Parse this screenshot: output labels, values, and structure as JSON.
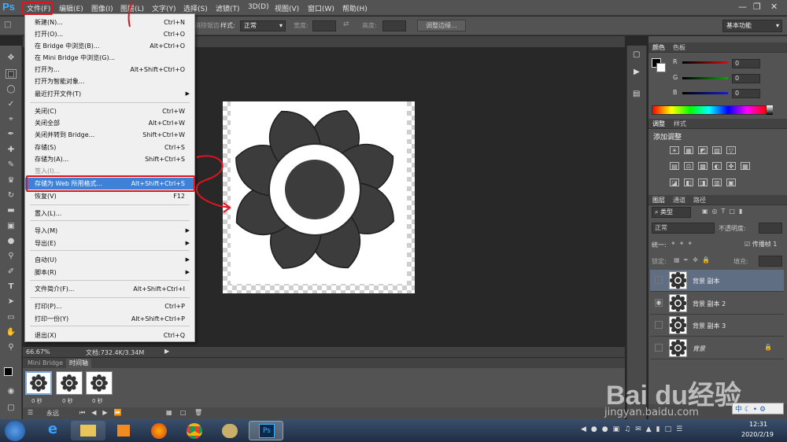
{
  "app": {
    "logo": "Ps"
  },
  "menubar": [
    "文件(F)",
    "编辑(E)",
    "图像(I)",
    "图层(L)",
    "文字(Y)",
    "选择(S)",
    "滤镜(T)",
    "3D(D)",
    "视图(V)",
    "窗口(W)",
    "帮助(H)"
  ],
  "options": {
    "feather_suffix": "消除锯齿",
    "style_label": "样式:",
    "style_value": "正常",
    "width_label": "宽度:",
    "height_label": "高度:",
    "refine_edge": "调整边缘...",
    "workspace": "基本功能"
  },
  "file_menu": [
    {
      "label": "新建(N)...",
      "shortcut": "Ctrl+N"
    },
    {
      "label": "打开(O)...",
      "shortcut": "Ctrl+O"
    },
    {
      "label": "在 Bridge 中浏览(B)...",
      "shortcut": "Alt+Ctrl+O"
    },
    {
      "label": "在 Mini Bridge 中浏览(G)...",
      "shortcut": ""
    },
    {
      "label": "打开为...",
      "shortcut": "Alt+Shift+Ctrl+O"
    },
    {
      "label": "打开为智能对象...",
      "shortcut": ""
    },
    {
      "label": "最近打开文件(T)",
      "shortcut": ""
    },
    {
      "label": "关闭(C)",
      "shortcut": "Ctrl+W"
    },
    {
      "label": "关闭全部",
      "shortcut": "Alt+Ctrl+W"
    },
    {
      "label": "关闭并转到 Bridge...",
      "shortcut": "Shift+Ctrl+W"
    },
    {
      "label": "存储(S)",
      "shortcut": "Ctrl+S"
    },
    {
      "label": "存储为(A)...",
      "shortcut": "Shift+Ctrl+S"
    },
    {
      "label": "签入(I)...",
      "shortcut": ""
    },
    {
      "label": "存储为 Web 所用格式...",
      "shortcut": "Alt+Shift+Ctrl+S"
    },
    {
      "label": "恢复(V)",
      "shortcut": "F12"
    },
    {
      "label": "置入(L)...",
      "shortcut": ""
    },
    {
      "label": "导入(M)",
      "shortcut": ""
    },
    {
      "label": "导出(E)",
      "shortcut": ""
    },
    {
      "label": "自动(U)",
      "shortcut": ""
    },
    {
      "label": "脚本(R)",
      "shortcut": ""
    },
    {
      "label": "文件简介(F)...",
      "shortcut": "Alt+Shift+Ctrl+I"
    },
    {
      "label": "打印(P)...",
      "shortcut": "Ctrl+P"
    },
    {
      "label": "打印一份(Y)",
      "shortcut": "Alt+Shift+Ctrl+P"
    },
    {
      "label": "退出(X)",
      "shortcut": "Ctrl+Q"
    }
  ],
  "status": {
    "zoom": "66.67%",
    "doc": "文档:732.4K/3.34M"
  },
  "timeline": {
    "tabs": [
      "Mini Bridge",
      "时间轴"
    ],
    "frames": [
      {
        "time": "0 秒"
      },
      {
        "time": "0 秒"
      },
      {
        "time": "0 秒"
      }
    ],
    "loop": "永远"
  },
  "color_panel": {
    "tabs": [
      "颜色",
      "色板"
    ],
    "channels": [
      {
        "name": "R",
        "value": "0",
        "color": "#d01010"
      },
      {
        "name": "G",
        "value": "0",
        "color": "#10a010"
      },
      {
        "name": "B",
        "value": "0",
        "color": "#1020d0"
      }
    ]
  },
  "adjust_panel": {
    "tabs": [
      "调整",
      "样式"
    ],
    "title": "添加调整"
  },
  "layers_panel": {
    "tabs": [
      "图层",
      "通道",
      "路径"
    ],
    "filter": "类型",
    "blend": "正常",
    "opacity_label": "不透明度:",
    "unify_label": "统一:",
    "propagate": "传播帧 1",
    "lock_label": "锁定:",
    "fill_label": "填充:",
    "layers": [
      {
        "name": "背景 副本",
        "visible": false,
        "selected": true
      },
      {
        "name": "背景 副本 2",
        "visible": true,
        "selected": false
      },
      {
        "name": "背景 副本 3",
        "visible": false,
        "selected": false
      },
      {
        "name": "背景",
        "visible": false,
        "selected": false
      }
    ]
  },
  "watermark": {
    "brand": "Bai du经验",
    "url": "jingyan.baidu.com"
  },
  "tray": {
    "ime": "中",
    "time": "12:31",
    "date": "2020/2/19"
  }
}
